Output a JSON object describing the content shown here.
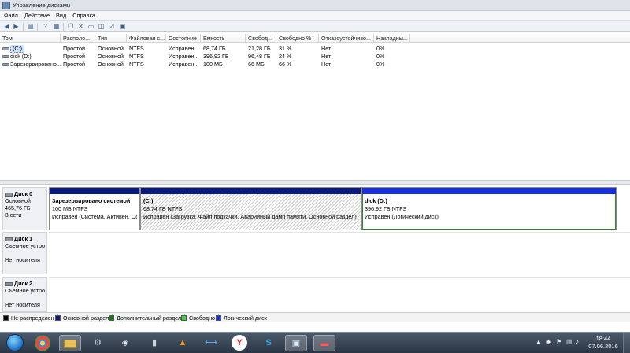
{
  "window": {
    "title": "Управление дисками",
    "menu": [
      "Файл",
      "Действие",
      "Вид",
      "Справка"
    ]
  },
  "toolbar": {
    "icons": [
      "back-icon",
      "forward-icon",
      "list-icon",
      "help-icon",
      "properties-icon",
      "delete-icon",
      "folder-icon",
      "open-icon",
      "check-icon",
      "export-icon"
    ]
  },
  "volumes": {
    "headers": [
      "Том",
      "Располо...",
      "Тип",
      "Файловая с...",
      "Состояние",
      "Емкость",
      "Свобод...",
      "Свободно %",
      "Отказоустойчиво...",
      "Накладны..."
    ],
    "rows": [
      [
        "(C:)",
        "Простой",
        "Основной",
        "NTFS",
        "Исправен...",
        "68,74 ГБ",
        "21,28 ГБ",
        "31 %",
        "Нет",
        "0%"
      ],
      [
        "dick (D:)",
        "Простой",
        "Основной",
        "NTFS",
        "Исправен...",
        "396,92 ГБ",
        "96,48 ГБ",
        "24 %",
        "Нет",
        "0%"
      ],
      [
        "Зарезервировано...",
        "Простой",
        "Основной",
        "NTFS",
        "Исправен...",
        "100 МБ",
        "66 МБ",
        "66 %",
        "Нет",
        "0%"
      ]
    ]
  },
  "disks": [
    {
      "name": "Диск 0",
      "type": "Основной",
      "size": "465,76 ГБ",
      "status": "В сети",
      "partitions": [
        {
          "name": "Зарезервировано системой",
          "size": "100 МБ NTFS",
          "status": "Исправен (Система, Активен, Ос"
        },
        {
          "name": "(C:)",
          "size": "68,74 ГБ NTFS",
          "status": "Исправен (Загрузка, Файл подкачки, Аварийный дамп памяти, Основной раздел)"
        },
        {
          "name": "dick  (D:)",
          "size": "396,92 ГБ NTFS",
          "status": "Исправен (Логический диск)"
        }
      ]
    },
    {
      "name": "Диск 1",
      "type": "Съемное устро",
      "size": "",
      "status": "Нет носителя"
    },
    {
      "name": "Диск 2",
      "type": "Съемное устро",
      "size": "",
      "status": "Нет носителя"
    }
  ],
  "legend": [
    {
      "label": "Не распределен",
      "color": "#000000"
    },
    {
      "label": "Основной раздел",
      "color": "#0a1a7a"
    },
    {
      "label": "Дополнительный раздел",
      "color": "#1f7a1f"
    },
    {
      "label": "Свободно",
      "color": "#3fd13f"
    },
    {
      "label": "Логический диск",
      "color": "#1a2fd6"
    }
  ],
  "colors": {
    "primary_partition": "#0a1a7a",
    "logical_drive": "#1a2fd6",
    "selection": "#2b8a2b"
  },
  "taskbar": {
    "apps": [
      "chrome-icon",
      "explorer-icon",
      "steam-icon",
      "unity-icon",
      "media-icon",
      "vlc-icon",
      "teamviewer-icon",
      "yandex-icon",
      "skype-icon",
      "network-app-icon",
      "disk-management-icon"
    ],
    "clock_time": "18:44",
    "clock_date": "07.06.2016"
  }
}
